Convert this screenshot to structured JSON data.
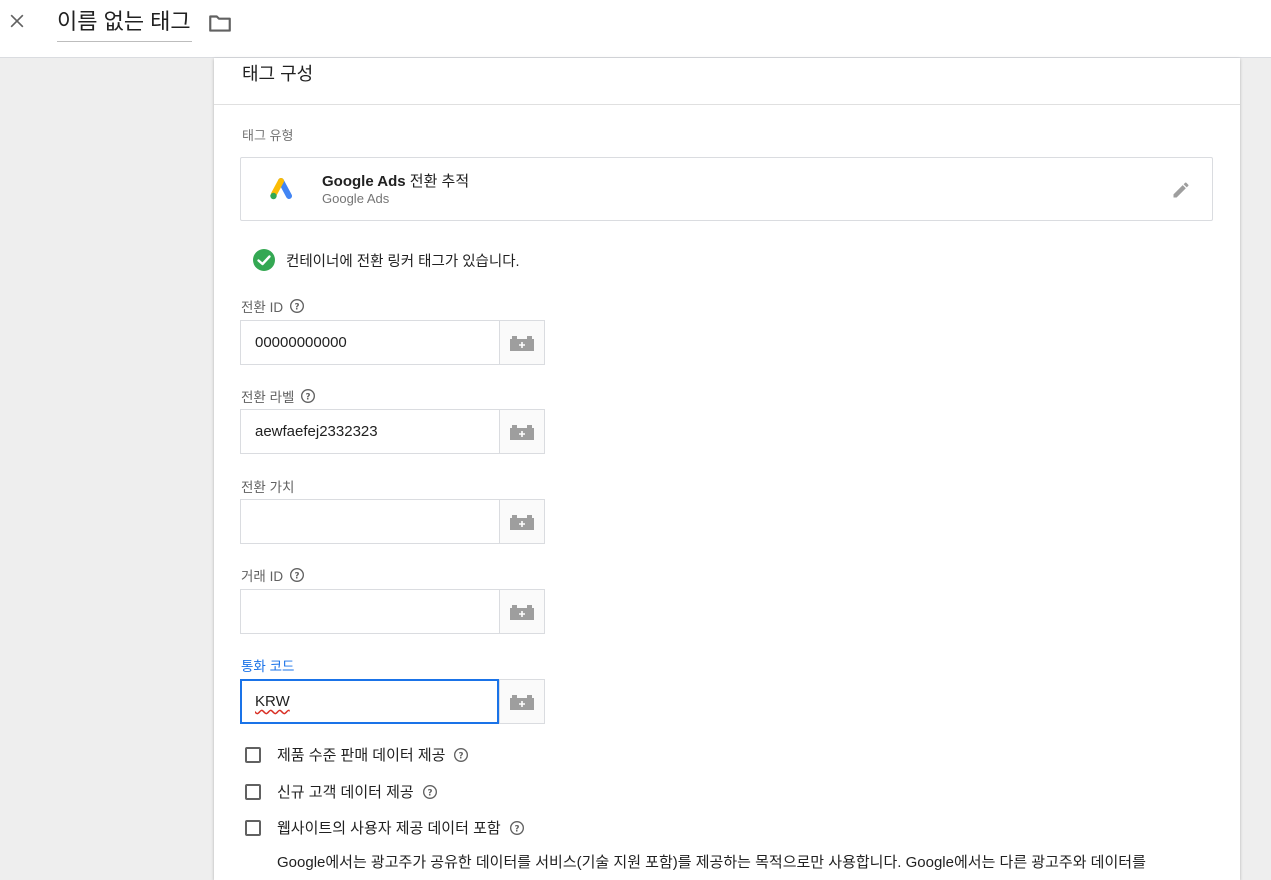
{
  "topbar": {
    "tag_name": "이름 없는 태그",
    "close_icon": "close-icon",
    "folder_icon": "folder-icon"
  },
  "panel": {
    "title": "태그 구성",
    "tag_type_label": "태그 유형",
    "tag_type": {
      "name_bold": "Google Ads",
      "name_rest": " 전환 추적",
      "vendor": "Google Ads",
      "logo": "google-ads-logo",
      "edit_icon": "edit-pencil-icon"
    },
    "status_message": "컨테이너에 전환 링커 태그가 있습니다.",
    "fields": {
      "conversion_id": {
        "label": "전환 ID",
        "value": "00000000000",
        "has_help": true
      },
      "conversion_label": {
        "label": "전환 라벨",
        "value": "aewfaefej2332323",
        "has_help": true
      },
      "conversion_value": {
        "label": "전환 가치",
        "value": "",
        "has_help": false
      },
      "transaction_id": {
        "label": "거래 ID",
        "value": "",
        "has_help": true
      },
      "currency_code": {
        "label": "통화 코드",
        "value": "KRW",
        "has_help": false,
        "focused": true
      }
    },
    "checkboxes": [
      {
        "label": "제품 수준 판매 데이터 제공",
        "checked": false
      },
      {
        "label": "신규 고객 데이터 제공",
        "checked": false
      },
      {
        "label": "웹사이트의 사용자 제공 데이터 포함",
        "checked": false
      }
    ],
    "disclaimer": "Google에서는 광고주가 공유한 데이터를 서비스(기술 지원 포함)를 제공하는 목적으로만 사용합니다. Google에서는 다른 광고주와 데이터를"
  },
  "colors": {
    "accent": "#1a73e8",
    "success": "#34a853",
    "ads_blue": "#4285f4",
    "ads_yellow": "#fbbc04",
    "ads_green": "#34a853"
  }
}
